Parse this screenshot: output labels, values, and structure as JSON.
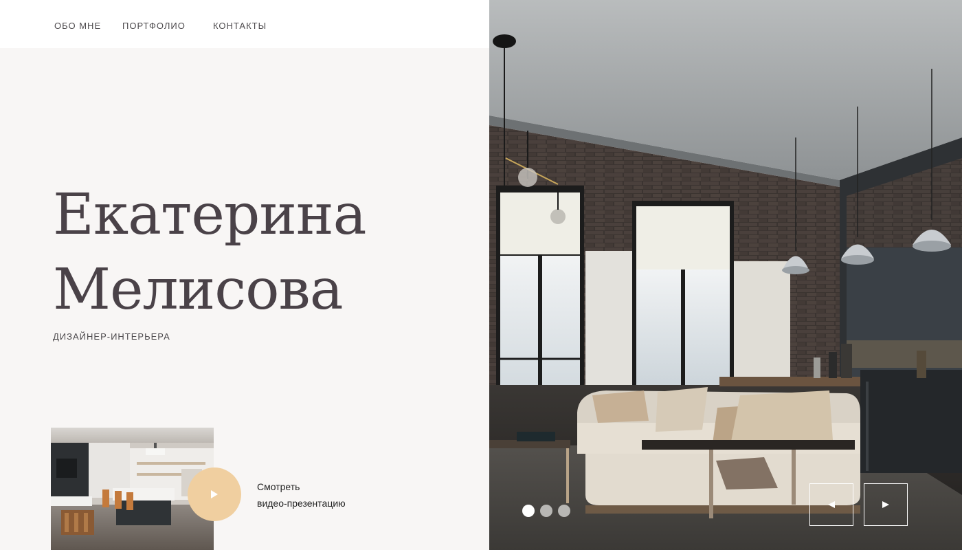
{
  "nav": {
    "items": [
      "ОБО МНЕ",
      "ПОРТФОЛИО",
      "КОНТАКТЫ"
    ]
  },
  "hero": {
    "name_line1": "Екатерина",
    "name_line2": "Мелисова",
    "subtitle": "ДИЗАЙНЕР-ИНТЕРЬЕРА"
  },
  "video": {
    "label_line1": "Смотреть",
    "label_line2": "видео-презентацию",
    "icon": "play-icon"
  },
  "slider": {
    "slide_count": 3,
    "active_slide": 1,
    "prev_icon": "arrow-left-icon",
    "next_icon": "arrow-right-icon"
  },
  "colors": {
    "accent": "#f0cfa0",
    "text": "#4a4248",
    "panel_bg": "#f8f6f5"
  }
}
